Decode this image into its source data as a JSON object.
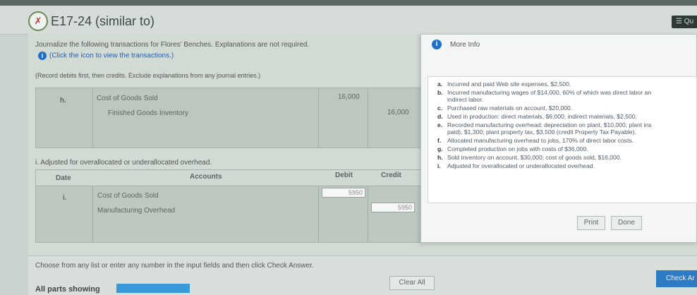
{
  "header": {
    "title": "E17-24 (similar to)",
    "status_icon": "partial-credit-icon",
    "corner_button": "Qu"
  },
  "question": {
    "instruction": "Journalize the following transactions for Flores' Benches. Explanations are not required.",
    "info_link": "(Click the icon to view the transactions.)",
    "record_note": "(Record debits first, then credits. Exclude explanations from any journal entries.)"
  },
  "entry_h": {
    "label": "h.",
    "debit_account": "Cost of Goods Sold",
    "credit_account": "Finished Goods Inventory",
    "debit": "16,000",
    "credit": "16,000"
  },
  "entry_i": {
    "section_label": "i. Adjusted for overallocated or underallocated overhead.",
    "headers": {
      "date": "Date",
      "accounts": "Accounts",
      "debit": "Debit",
      "credit": "Credit"
    },
    "label": "i.",
    "debit_account": "Cost of Goods Sold",
    "credit_account": "Manufacturing Overhead",
    "debit_value": "5950",
    "credit_value": "5950"
  },
  "footer": {
    "choose_text": "Choose from any list or enter any number in the input fields and then click Check Answer.",
    "clear_button": "Clear All",
    "check_button": "Check Ar",
    "parts_text": "All parts showing"
  },
  "modal": {
    "title": "More Info",
    "items": [
      {
        "letter": "a.",
        "lines": [
          "Incurred and paid Web site expenses, $2,500."
        ]
      },
      {
        "letter": "b.",
        "lines": [
          "Incurred manufacturing wages of $14,000, 60% of which was direct labor an",
          "indirect labor."
        ]
      },
      {
        "letter": "c.",
        "lines": [
          "Purchased raw materials on account, $20,000."
        ]
      },
      {
        "letter": "d.",
        "lines": [
          "Used in production: direct materials, $6,000; indirect materials, $2,500."
        ]
      },
      {
        "letter": "e.",
        "lines": [
          "Recorded manufacturing overhead: depreciation on plant, $10,000; plant ins",
          "paid), $1,300; plant property tax, $3,500 (credit Property Tax Payable)."
        ]
      },
      {
        "letter": "f.",
        "lines": [
          "Allocated manufacturing overhead to jobs, 170% of direct labor costs."
        ]
      },
      {
        "letter": "g.",
        "lines": [
          "Completed production on jobs with costs of $36,000."
        ]
      },
      {
        "letter": "h.",
        "lines": [
          "Sold inventory on account, $30,000; cost of goods sold, $16,000."
        ]
      },
      {
        "letter": "i.",
        "lines": [
          "Adjusted for overallocated or underallocated overhead."
        ]
      }
    ],
    "print_button": "Print",
    "done_button": "Done"
  }
}
